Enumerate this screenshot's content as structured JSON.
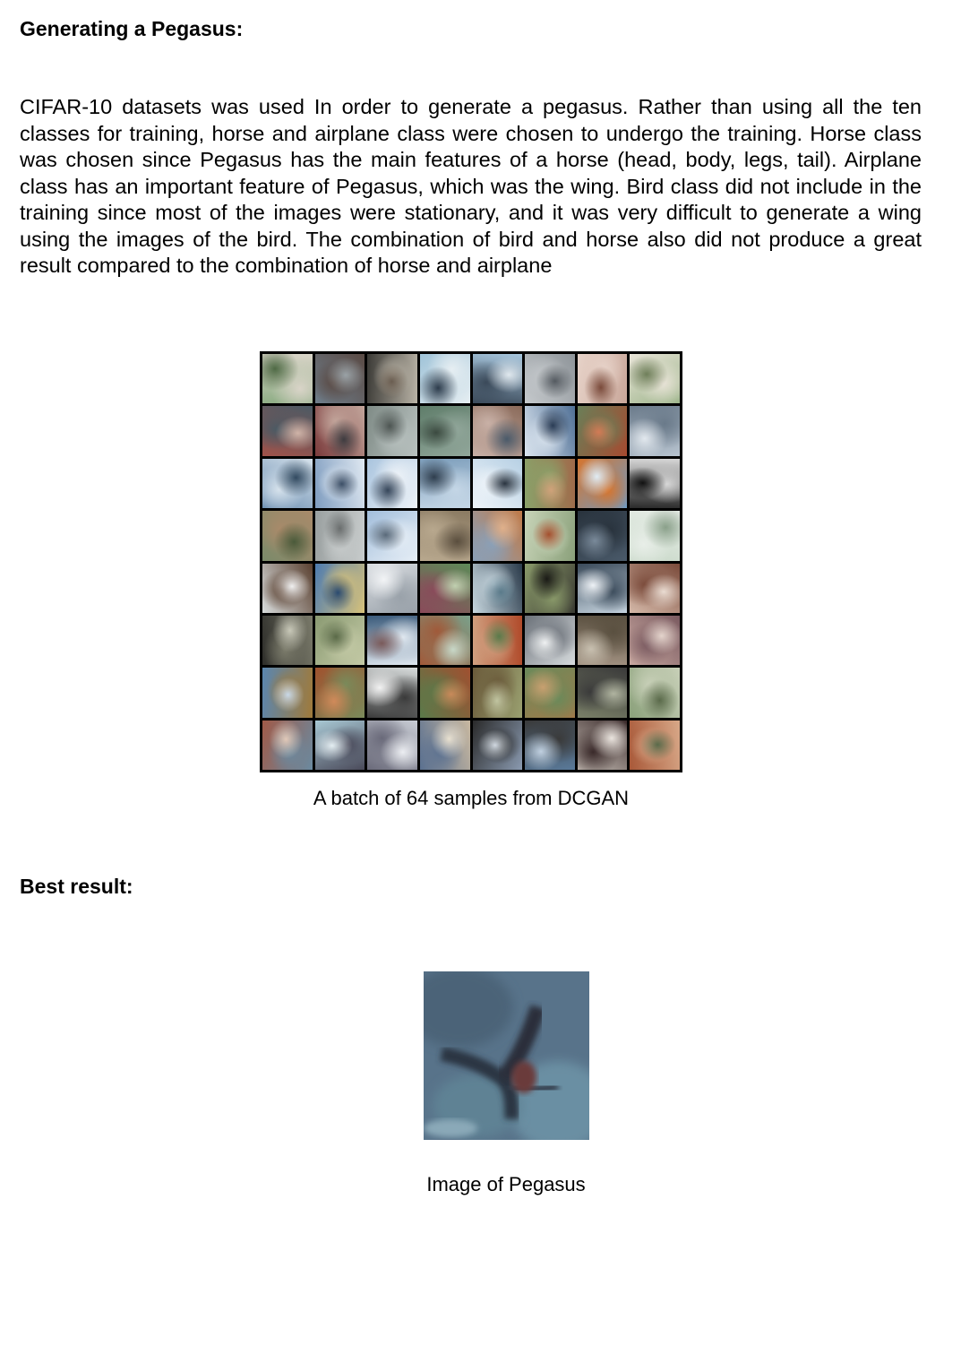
{
  "section1": {
    "heading": "Generating a Pegasus:",
    "paragraph": "CIFAR-10 datasets was used In order to generate a pegasus. Rather than using all the ten classes for training, horse and airplane class were chosen to undergo the training. Horse class was chosen since Pegasus has the main features of a horse (head, body, legs, tail). Airplane class has an important feature of Pegasus, which was the wing. Bird class did not include in the training since most of the images were stationary, and it was very difficult to generate a wing using the images of the bird. The combination of bird and horse also did not produce a great result compared to the combination of horse and airplane"
  },
  "figure1": {
    "caption": "A batch of 64 samples from DCGAN"
  },
  "section2": {
    "heading": "Best result:"
  },
  "figure2": {
    "caption": "Image of Pegasus"
  }
}
